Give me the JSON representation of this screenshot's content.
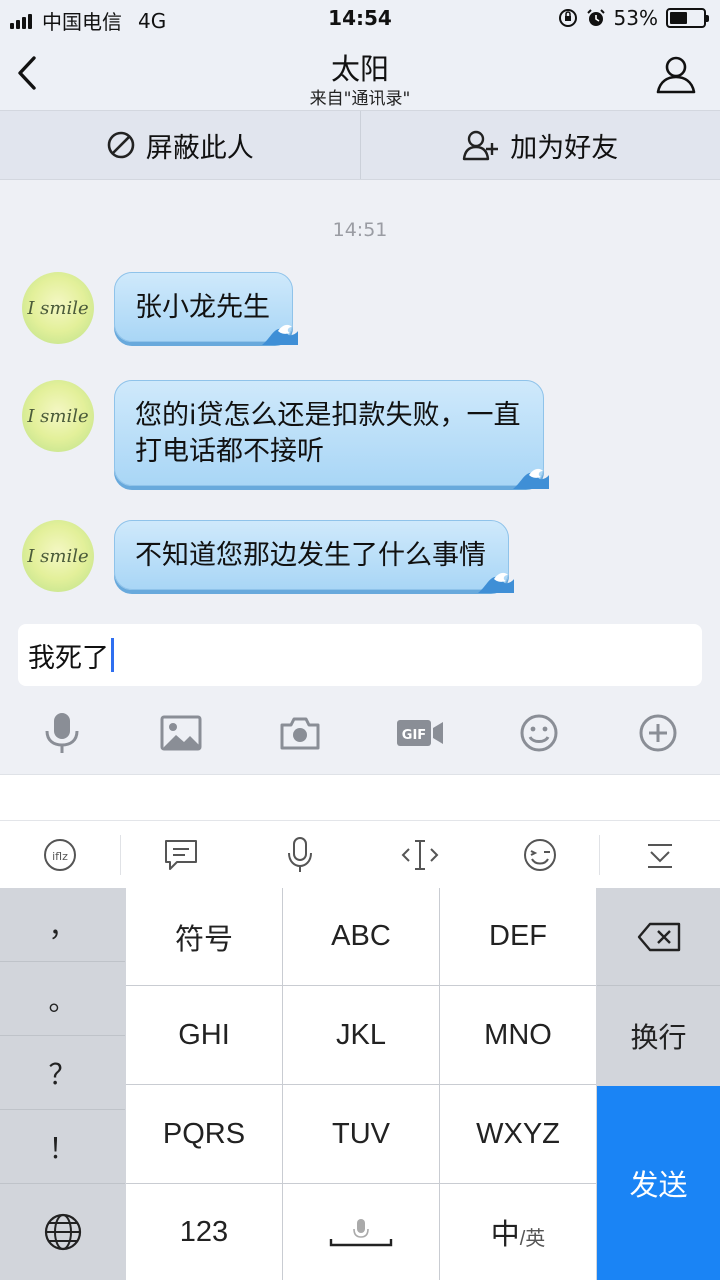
{
  "status_bar": {
    "carrier": "中国电信",
    "network": "4G",
    "time": "14:54",
    "battery": "53%",
    "battery_level": 0.53
  },
  "nav": {
    "title": "太阳",
    "subtitle": "来自\"通讯录\""
  },
  "actions": {
    "block": "屏蔽此人",
    "add_friend": "加为好友"
  },
  "chat": {
    "timestamp": "14:51",
    "avatar_text": "I smile",
    "messages": [
      {
        "line1": "张小龙先生",
        "line2": ""
      },
      {
        "line1": "您的i贷怎么还是扣款失败，一直",
        "line2": "打电话都不接听"
      },
      {
        "line1": "不知道您那边发生了什么事情",
        "line2": ""
      }
    ]
  },
  "input": {
    "value": "我死了"
  },
  "keyboard": {
    "punctuation": [
      "，",
      "。",
      "？",
      "！"
    ],
    "keys": [
      "符号",
      "ABC",
      "DEF",
      "GHI",
      "JKL",
      "MNO",
      "PQRS",
      "TUV",
      "WXYZ",
      "123",
      "",
      "中/英"
    ],
    "zh_en_main": "中",
    "zh_en_sub": "/英",
    "return": "换行",
    "send": "发送"
  },
  "colors": {
    "accent": "#1a84f5",
    "bubble": "#bfe2fa",
    "caret": "#2f6ff0"
  }
}
